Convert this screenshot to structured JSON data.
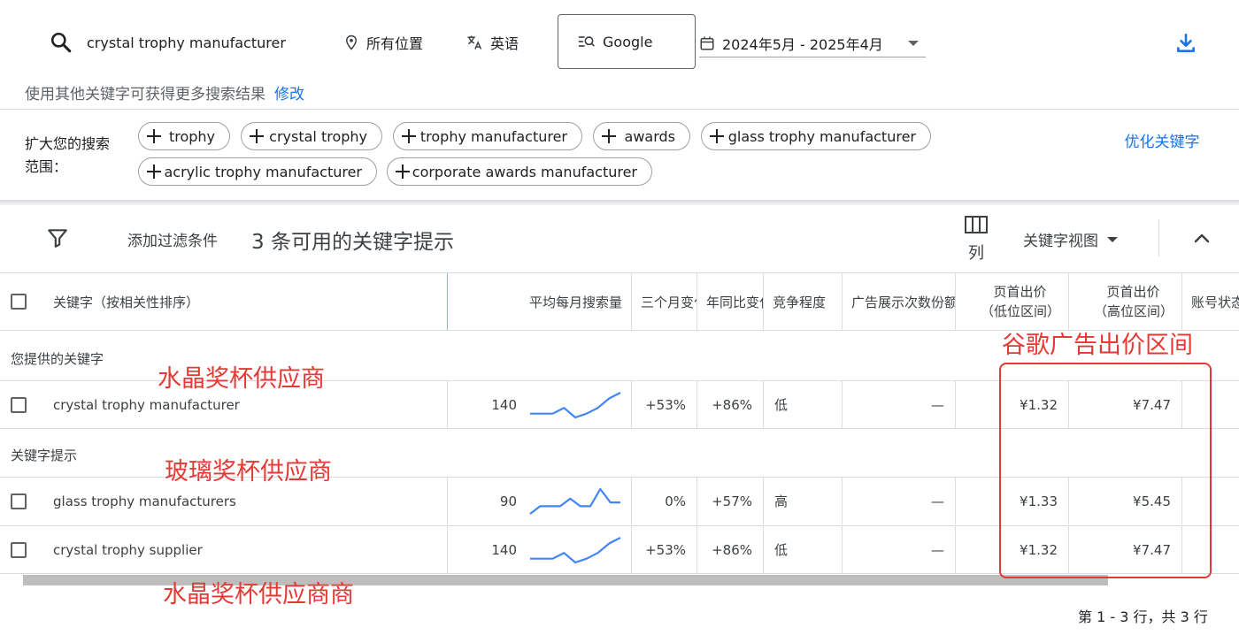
{
  "header": {
    "search_query": "crystal trophy manufacturer",
    "location": "所有位置",
    "language": "英语",
    "search_engine": "Google",
    "date_range": "2024年5月 - 2025年4月"
  },
  "hint": {
    "text": "使用其他关键字可获得更多搜索结果",
    "link": "修改"
  },
  "expand": {
    "label": "扩大您的搜索范围：",
    "chips": [
      "trophy",
      "crystal trophy",
      "trophy manufacturer",
      "awards",
      "glass trophy manufacturer",
      "acrylic trophy manufacturer",
      "corporate awards manufacturer"
    ],
    "optimize": "优化关键字"
  },
  "toolbar": {
    "add_filter": "添加过滤条件",
    "count_title": "3 条可用的关键字提示",
    "columns_label": "列",
    "view_label": "关键字视图"
  },
  "table": {
    "headers": {
      "keyword": "关键字（按相关性排序）",
      "avg_searches": "平均每月搜索量",
      "three_month": "三个月变化",
      "yoy": "年同比变化",
      "competition": "竞争程度",
      "impression_share": "广告展示次数份额",
      "bid_low": "页首出价（低位区间）",
      "bid_high": "页首出价（高位区间）",
      "account_status": "账号状态"
    },
    "group_provided": "您提供的关键字",
    "group_suggested": "关键字提示",
    "rows": [
      {
        "keyword": "crystal trophy manufacturer",
        "searches": "140",
        "three_month": "+53%",
        "yoy": "+86%",
        "competition": "低",
        "impression": "—",
        "bid_low": "¥1.32",
        "bid_high": "¥7.47",
        "trend": [
          3,
          3,
          3,
          6,
          1,
          3,
          6,
          11,
          14
        ]
      },
      {
        "keyword": "glass trophy manufacturers",
        "searches": "90",
        "three_month": "0%",
        "yoy": "+57%",
        "competition": "高",
        "impression": "—",
        "bid_low": "¥1.33",
        "bid_high": "¥5.45",
        "trend": [
          1,
          5,
          5,
          5,
          9,
          5,
          5,
          14,
          7,
          7
        ]
      },
      {
        "keyword": "crystal trophy supplier",
        "searches": "140",
        "three_month": "+53%",
        "yoy": "+86%",
        "competition": "低",
        "impression": "—",
        "bid_low": "¥1.32",
        "bid_high": "¥7.47",
        "trend": [
          3,
          3,
          3,
          6,
          1,
          3,
          6,
          11,
          14
        ]
      }
    ]
  },
  "footer": {
    "pagination": "第 1 - 3 行，共 3 行"
  },
  "annotations": {
    "bid_range": "谷歌广告出价区间",
    "row1": "水晶奖杯供应商",
    "row2": "玻璃奖杯供应商",
    "row3": "水晶奖杯供应商商"
  },
  "colors": {
    "accent": "#1a73e8",
    "annotation": "#e53935",
    "trend": "#4285f4"
  }
}
